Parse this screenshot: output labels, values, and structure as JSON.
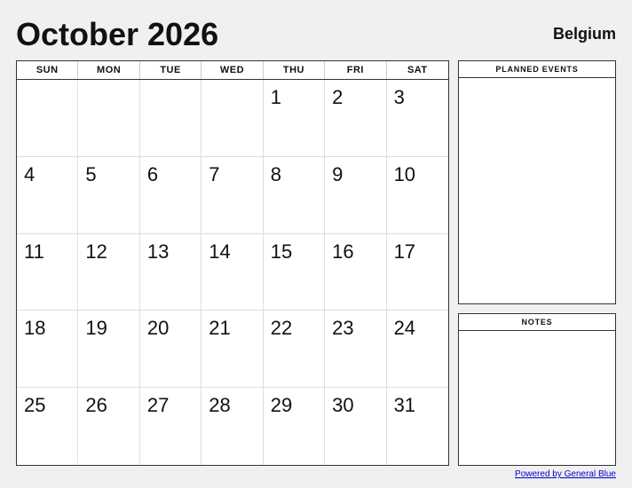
{
  "header": {
    "title": "October 2026",
    "country": "Belgium"
  },
  "calendar": {
    "days_of_week": [
      "SUN",
      "MON",
      "TUE",
      "WED",
      "THU",
      "FRI",
      "SAT"
    ],
    "weeks": [
      [
        null,
        null,
        null,
        null,
        1,
        2,
        3
      ],
      [
        4,
        5,
        6,
        7,
        8,
        9,
        10
      ],
      [
        11,
        12,
        13,
        14,
        15,
        16,
        17
      ],
      [
        18,
        19,
        20,
        21,
        22,
        23,
        24
      ],
      [
        25,
        26,
        27,
        28,
        29,
        30,
        31
      ]
    ]
  },
  "sidebar": {
    "planned_events_label": "PLANNED EVENTS",
    "notes_label": "NOTES"
  },
  "footer": {
    "link_text": "Powered by General Blue",
    "link_url": "#"
  }
}
